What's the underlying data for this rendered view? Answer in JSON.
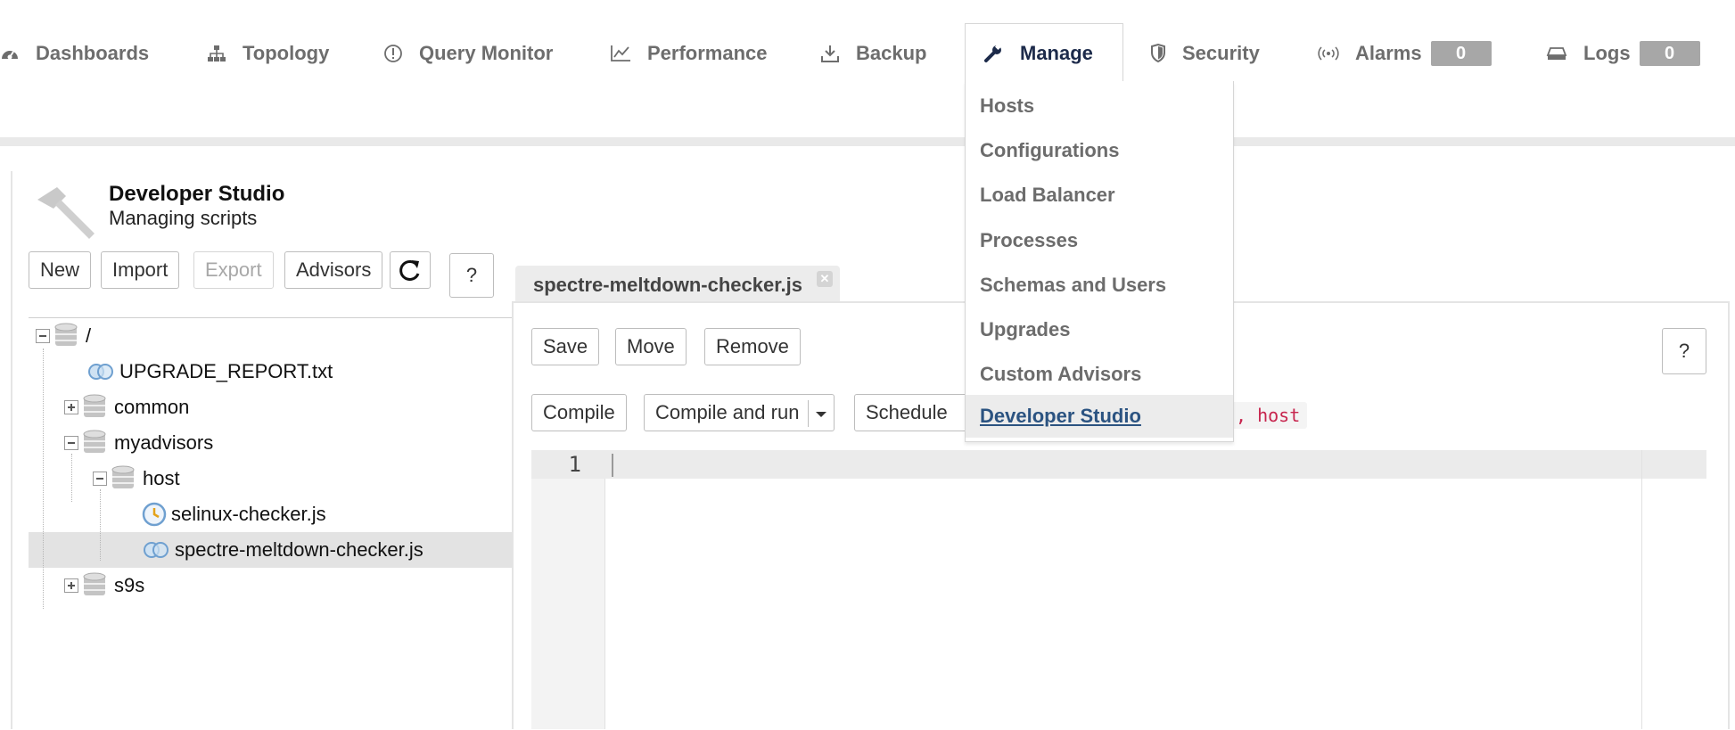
{
  "nav": {
    "dashboards": "Dashboards",
    "topology": "Topology",
    "query_monitor": "Query Monitor",
    "performance": "Performance",
    "backup": "Backup",
    "manage": "Manage",
    "security": "Security",
    "alarms": "Alarms",
    "alarms_count": "0",
    "logs": "Logs",
    "logs_count": "0",
    "active_item": "Manage"
  },
  "manage_menu": {
    "items": [
      "Hosts",
      "Configurations",
      "Load Balancer",
      "Processes",
      "Schemas and Users",
      "Upgrades",
      "Custom Advisors",
      "Developer Studio"
    ],
    "selected": "Developer Studio"
  },
  "page": {
    "title": "Developer Studio",
    "subtitle": "Managing scripts"
  },
  "toolbar": {
    "new": "New",
    "import": "Import",
    "export": "Export",
    "advisors": "Advisors",
    "refresh_icon": "refresh-icon",
    "help": "?"
  },
  "tree": {
    "root": "/",
    "upgrade_report": "UPGRADE_REPORT.txt",
    "common": "common",
    "myadvisors": "myadvisors",
    "host": "host",
    "selinux": "selinux-checker.js",
    "spectre": "spectre-meltdown-checker.js",
    "s9s": "s9s",
    "selected": "spectre-meltdown-checker.js"
  },
  "editor": {
    "tab_title": "spectre-meltdown-checker.js",
    "save": "Save",
    "move": "Move",
    "remove": "Remove",
    "help": "?",
    "compile": "Compile",
    "compile_and_run": "Compile and run",
    "schedule": "Schedule Ac",
    "hint": ", host",
    "line_number": "1"
  },
  "colors": {
    "active_nav": "#1c2a4a",
    "menu_selected": "#2b5381",
    "badge": "#a7a7a7",
    "hint": "#c7254e"
  }
}
